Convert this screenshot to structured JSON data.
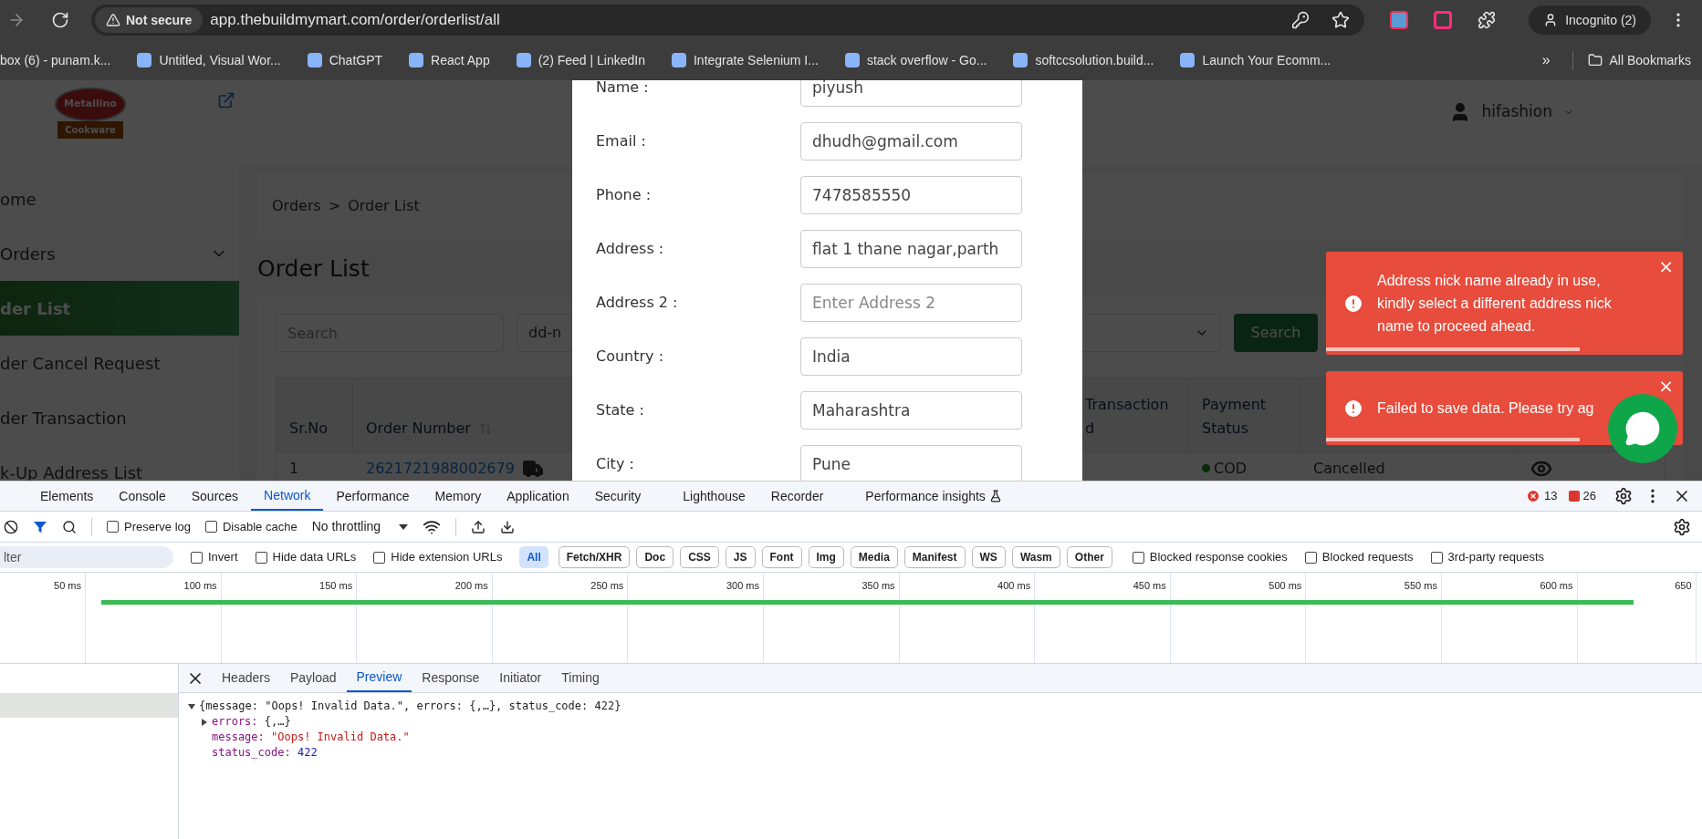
{
  "browser": {
    "security": "Not secure",
    "url": "app.thebuildmymart.com/order/orderlist/all",
    "profile": "Incognito (2)",
    "bookmarks": [
      {
        "label": "box (6) - punam.k..."
      },
      {
        "label": "Untitled, Visual Wor..."
      },
      {
        "label": "ChatGPT"
      },
      {
        "label": "React App"
      },
      {
        "label": "(2) Feed | LinkedIn"
      },
      {
        "label": "Integrate Selenium I..."
      },
      {
        "label": "stack overflow - Go..."
      },
      {
        "label": "softccsolution.build..."
      },
      {
        "label": "Launch Your Ecomm..."
      }
    ],
    "more": "»",
    "all_bookmarks": "All Bookmarks"
  },
  "app": {
    "logo": {
      "name": "Metallino",
      "tagline": "Cookware"
    },
    "user": "hifashion",
    "sidebar": [
      {
        "label": "ome",
        "selected": false,
        "expandable": false
      },
      {
        "label": "Orders",
        "selected": false,
        "expandable": true
      },
      {
        "label": "der List",
        "selected": true,
        "expandable": false
      },
      {
        "label": "der Cancel Request",
        "selected": false,
        "expandable": false
      },
      {
        "label": "der Transaction",
        "selected": false,
        "expandable": false
      },
      {
        "label": "k-Up Address List",
        "selected": false,
        "expandable": false
      }
    ],
    "breadcrumb": [
      "Orders",
      "Order List"
    ],
    "breadcrumb_separator": ">",
    "heading": "Order List",
    "filters": {
      "search_placeholder": "Search",
      "select_value": "dd-n",
      "search_button": "Search"
    },
    "table": {
      "columns": [
        {
          "lines": [
            "Sr.No"
          ],
          "sortable": false
        },
        {
          "lines": [
            "Order Number"
          ],
          "sortable": true
        },
        {
          "lines": [
            "Transaction",
            "d"
          ],
          "sortable": false
        },
        {
          "lines": [
            "Payment",
            "Status"
          ],
          "sortable": false
        }
      ],
      "rows": [
        {
          "sr_no": "1",
          "order_number": "2621721988002679",
          "payment": "COD",
          "status": "Cancelled"
        }
      ]
    }
  },
  "modal": {
    "fields": [
      {
        "label": "Name :",
        "value": "piyush"
      },
      {
        "label": "Email :",
        "value": "dhudh@gmail.com"
      },
      {
        "label": "Phone :",
        "value": "7478585550"
      },
      {
        "label": "Address :",
        "value": "flat 1 thane nagar,parth"
      },
      {
        "label": "Address 2 :",
        "placeholder": "Enter Address 2"
      },
      {
        "label": "Country :",
        "value": "India"
      },
      {
        "label": "State :",
        "value": "Maharashtra"
      },
      {
        "label": "City :",
        "value": "Pune"
      }
    ]
  },
  "toasts": [
    {
      "message": "Address nick name already in use, kindly select a different address nick name to proceed ahead.",
      "close": "×",
      "level": 0.71
    },
    {
      "message": "Failed to save data. Please try ag",
      "close": "×",
      "level": 0.71
    }
  ],
  "devtools": {
    "tabs": [
      {
        "label": "Elements",
        "selected": false
      },
      {
        "label": "Console",
        "selected": false
      },
      {
        "label": "Sources",
        "selected": false
      },
      {
        "label": "Network",
        "selected": true
      },
      {
        "label": "Performance",
        "selected": false
      },
      {
        "label": "Memory",
        "selected": false
      },
      {
        "label": "Application",
        "selected": false
      },
      {
        "label": "Security",
        "selected": false
      },
      {
        "label": "Lighthouse",
        "selected": false
      },
      {
        "label": "Recorder",
        "selected": false
      },
      {
        "label": "Performance insights",
        "selected": false
      }
    ],
    "errors": "13",
    "issues": "26",
    "toolbar": {
      "preserve_log": {
        "label": "Preserve log",
        "checked": false
      },
      "disable_cache": {
        "label": "Disable cache",
        "checked": false
      },
      "throttling": "No throttling"
    },
    "filter_placeholder": "lter",
    "filter_checks": [
      {
        "label": "Invert",
        "checked": false
      },
      {
        "label": "Hide data URLs",
        "checked": false
      },
      {
        "label": "Hide extension URLs",
        "checked": false
      }
    ],
    "types": [
      {
        "label": "All",
        "selected": true
      },
      {
        "label": "Fetch/XHR",
        "selected": false
      },
      {
        "label": "Doc",
        "selected": false
      },
      {
        "label": "CSS",
        "selected": false
      },
      {
        "label": "JS",
        "selected": false
      },
      {
        "label": "Font",
        "selected": false
      },
      {
        "label": "Img",
        "selected": false
      },
      {
        "label": "Media",
        "selected": false
      },
      {
        "label": "Manifest",
        "selected": false
      },
      {
        "label": "WS",
        "selected": false
      },
      {
        "label": "Wasm",
        "selected": false
      },
      {
        "label": "Other",
        "selected": false
      }
    ],
    "more_checks": [
      {
        "label": "Blocked response cookies",
        "checked": false
      },
      {
        "label": "Blocked requests",
        "checked": false
      },
      {
        "label": "3rd-party requests",
        "checked": false
      }
    ],
    "timeline_ticks": [
      "50 ms",
      "100 ms",
      "150 ms",
      "200 ms",
      "250 ms",
      "300 ms",
      "350 ms",
      "400 ms",
      "450 ms",
      "500 ms",
      "550 ms",
      "600 ms",
      "650"
    ],
    "detail_tabs": [
      {
        "label": "Headers",
        "selected": false
      },
      {
        "label": "Payload",
        "selected": false
      },
      {
        "label": "Preview",
        "selected": true
      },
      {
        "label": "Response",
        "selected": false
      },
      {
        "label": "Initiator",
        "selected": false
      },
      {
        "label": "Timing",
        "selected": false
      }
    ],
    "preview": [
      {
        "kind": "summary",
        "expanded": true,
        "text": "{message: \"Oops! Invalid Data.\", errors: {,…}, status_code: 422}",
        "children": [
          {
            "kind": "object",
            "expanded": false,
            "key": "errors:",
            "value": "{,…}"
          },
          {
            "kind": "string",
            "key": "message:",
            "value": "\"Oops! Invalid Data.\""
          },
          {
            "kind": "number",
            "key": "status_code:",
            "value": "422"
          }
        ]
      }
    ]
  }
}
